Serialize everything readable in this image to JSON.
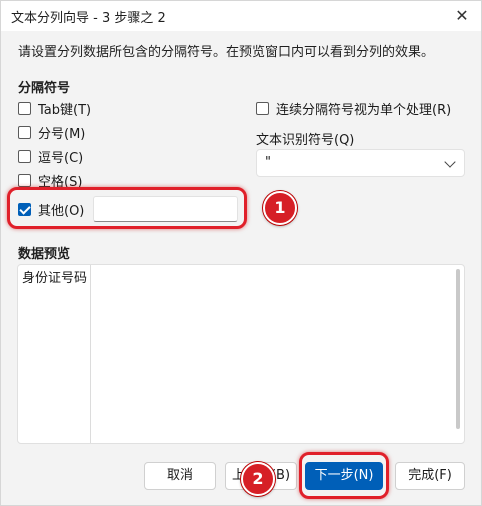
{
  "window": {
    "title": "文本分列向导 - 3 步骤之 2",
    "close_glyph": "✕"
  },
  "description": "请设置分列数据所包含的分隔符号。在预览窗口内可以看到分列的效果。",
  "delimiters": {
    "section_label": "分隔符号",
    "items": [
      {
        "label": "Tab键(T)",
        "checked": false
      },
      {
        "label": "分号(M)",
        "checked": false
      },
      {
        "label": "逗号(C)",
        "checked": false
      },
      {
        "label": "空格(S)",
        "checked": false
      },
      {
        "label": "其他(O)",
        "checked": true
      }
    ],
    "other_value": ""
  },
  "consecutive": {
    "label": "连续分隔符号视为单个处理(R)",
    "checked": false
  },
  "text_qualifier": {
    "label": "文本识别符号(Q)",
    "value": "\""
  },
  "preview": {
    "section_label": "数据预览",
    "column_header": "身份证号码"
  },
  "buttons": {
    "cancel": "取消",
    "back": "上一步(B)",
    "next": "下一步(N)",
    "finish": "完成(F)"
  },
  "annotations": {
    "badge_1": "1",
    "badge_2": "2",
    "color": "#e0202a"
  }
}
